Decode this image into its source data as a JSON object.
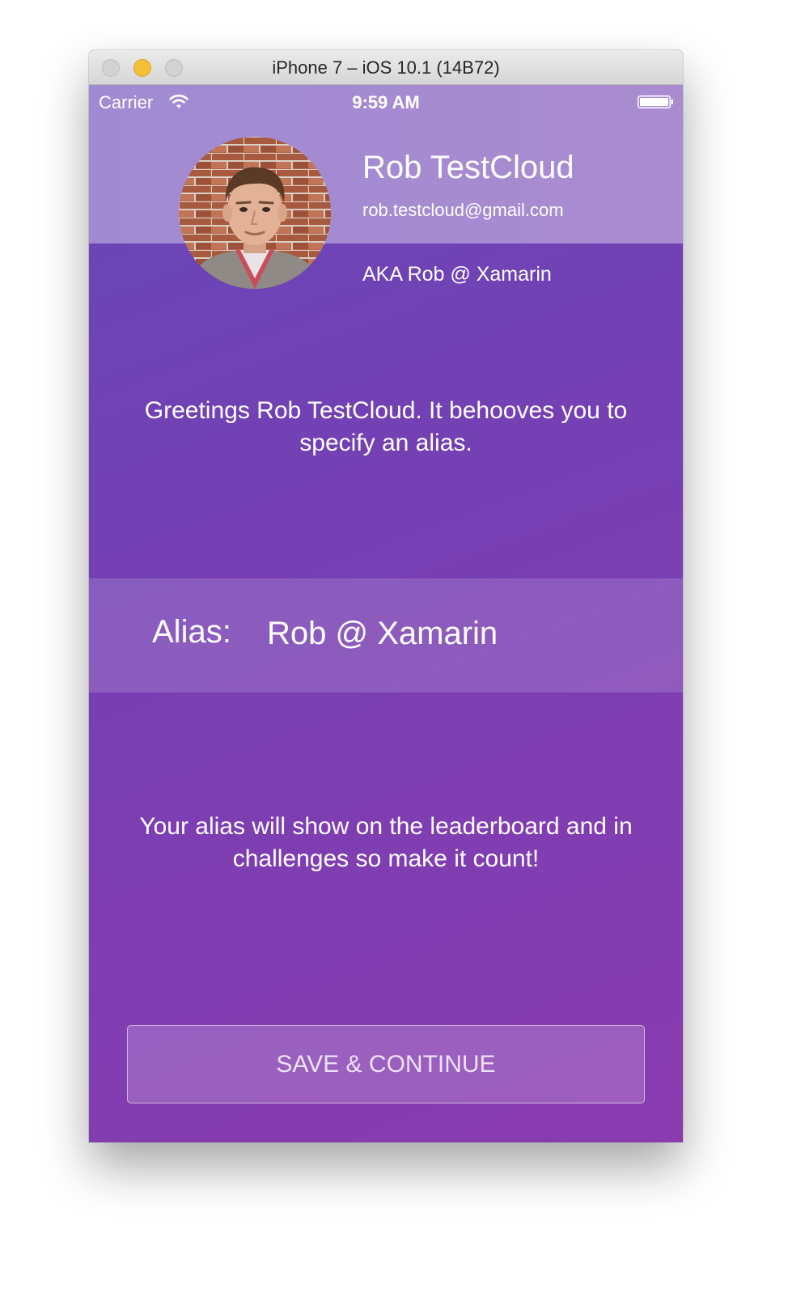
{
  "window": {
    "title": "iPhone 7 – iOS 10.1 (14B72)"
  },
  "status_bar": {
    "carrier": "Carrier",
    "time": "9:59 AM",
    "wifi_icon": "wifi-icon",
    "battery_icon": "battery-icon"
  },
  "profile": {
    "name": "Rob TestCloud",
    "email": "rob.testcloud@gmail.com",
    "aka": "AKA Rob @ Xamarin",
    "avatar_icon": "profile-photo"
  },
  "greeting": "Greetings Rob TestCloud. It behooves you to specify an alias.",
  "alias": {
    "label": "Alias:",
    "value": "Rob @ Xamarin"
  },
  "info": "Your alias will show on the leaderboard and in challenges so make it count!",
  "save_button": {
    "label": "SAVE & CONTINUE"
  },
  "colors": {
    "header_band": "#a58bd1",
    "background_start": "#6648b8",
    "background_end": "#8a3bb0",
    "text": "#ffffff"
  }
}
